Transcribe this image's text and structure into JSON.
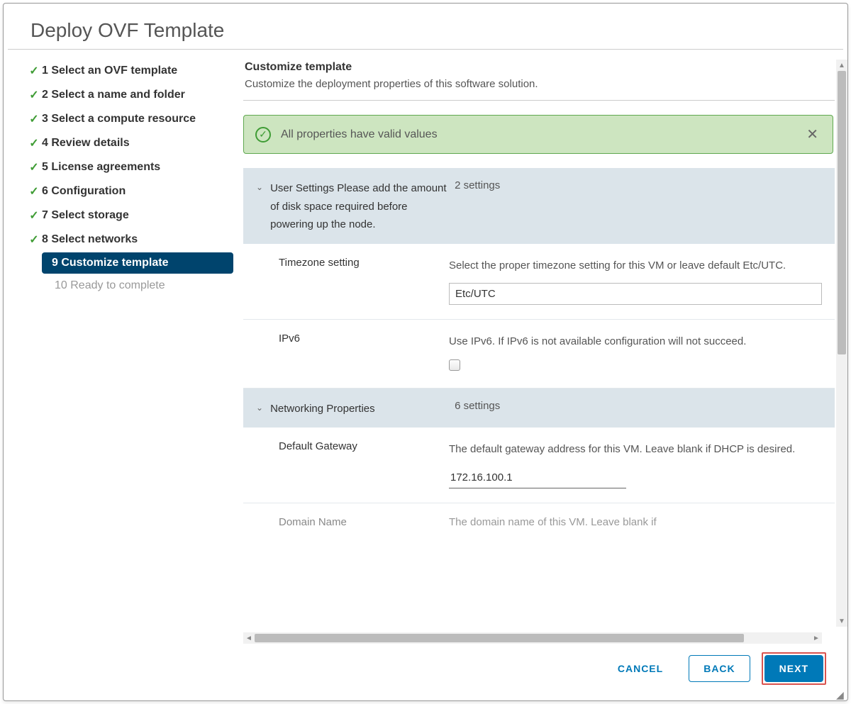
{
  "title": "Deploy OVF Template",
  "steps": [
    {
      "label": "1 Select an OVF template",
      "state": "done"
    },
    {
      "label": "2 Select a name and folder",
      "state": "done"
    },
    {
      "label": "3 Select a compute resource",
      "state": "done"
    },
    {
      "label": "4 Review details",
      "state": "done"
    },
    {
      "label": "5 License agreements",
      "state": "done"
    },
    {
      "label": "6 Configuration",
      "state": "done"
    },
    {
      "label": "7 Select storage",
      "state": "done"
    },
    {
      "label": "8 Select networks",
      "state": "done"
    },
    {
      "label": "9 Customize template",
      "state": "current"
    },
    {
      "label": "10 Ready to complete",
      "state": "future"
    }
  ],
  "section": {
    "title": "Customize template",
    "subtitle": "Customize the deployment properties of this software solution."
  },
  "banner_text": "All properties have valid values",
  "groups": {
    "user": {
      "label": "User Settings Please add the amount of disk space required before powering up the node.",
      "count": "2 settings",
      "timezone": {
        "label": "Timezone setting",
        "desc": "Select the proper timezone setting for this VM or leave default Etc/UTC.",
        "value": "Etc/UTC"
      },
      "ipv6": {
        "label": "IPv6",
        "desc": "Use IPv6. If IPv6 is not available configuration will not succeed."
      }
    },
    "net": {
      "label": "Networking Properties",
      "count": "6 settings",
      "gateway": {
        "label": "Default Gateway",
        "desc": "The default gateway address for this VM. Leave blank if DHCP is desired.",
        "value": "172.16.100.1"
      },
      "domain": {
        "label": "Domain Name",
        "desc": "The domain name of this VM. Leave blank if"
      }
    }
  },
  "buttons": {
    "cancel": "CANCEL",
    "back": "BACK",
    "next": "NEXT"
  }
}
